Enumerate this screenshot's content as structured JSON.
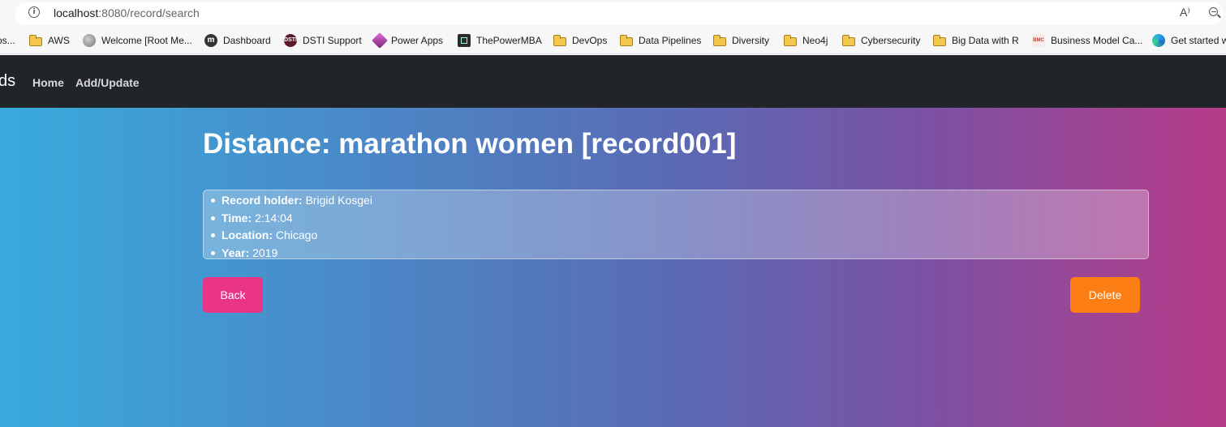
{
  "browser": {
    "url_host": "localhost",
    "url_rest": ":8080/record/search",
    "read_aloud": "A⁾"
  },
  "bookmarks": {
    "truncated_first": "os...",
    "items": [
      {
        "label": "AWS",
        "icon": "folder-icon"
      },
      {
        "label": "Welcome [Root Me...",
        "icon": "globe-icon"
      },
      {
        "label": "Dashboard",
        "icon": "m-logo-icon",
        "glyph": "m"
      },
      {
        "label": "DSTI Support",
        "icon": "dsti-icon",
        "glyph": "DSTI"
      },
      {
        "label": "Power Apps",
        "icon": "power-apps-icon"
      },
      {
        "label": "ThePowerMBA",
        "icon": "powermba-icon"
      },
      {
        "label": "DevOps",
        "icon": "folder-icon"
      },
      {
        "label": "Data Pipelines",
        "icon": "folder-icon"
      },
      {
        "label": "Diversity",
        "icon": "folder-icon"
      },
      {
        "label": "Neo4j",
        "icon": "folder-icon"
      },
      {
        "label": "Cybersecurity",
        "icon": "folder-icon"
      },
      {
        "label": "Big Data with R",
        "icon": "folder-icon"
      },
      {
        "label": "Business Model Ca...",
        "icon": "bmc-icon",
        "glyph": "BMC"
      },
      {
        "label": "Get started w",
        "icon": "edge-icon"
      }
    ]
  },
  "navbar": {
    "brand": "ds",
    "links": [
      "Home",
      "Add/Update"
    ]
  },
  "record": {
    "title": "Distance: marathon women [record001]",
    "fields": [
      {
        "label": "Record holder:",
        "value": "Brigid Kosgei"
      },
      {
        "label": "Time:",
        "value": "2:14:04"
      },
      {
        "label": "Location:",
        "value": "Chicago"
      },
      {
        "label": "Year:",
        "value": "2019"
      }
    ]
  },
  "actions": {
    "back_label": "Back",
    "delete_label": "Delete"
  },
  "colors": {
    "navbar_bg": "#212428",
    "back_button": "#ea3485",
    "delete_button": "#fd7e14",
    "gradient": [
      "#38abdc",
      "#5a6ab4",
      "#7a52a4",
      "#b63c89"
    ]
  }
}
